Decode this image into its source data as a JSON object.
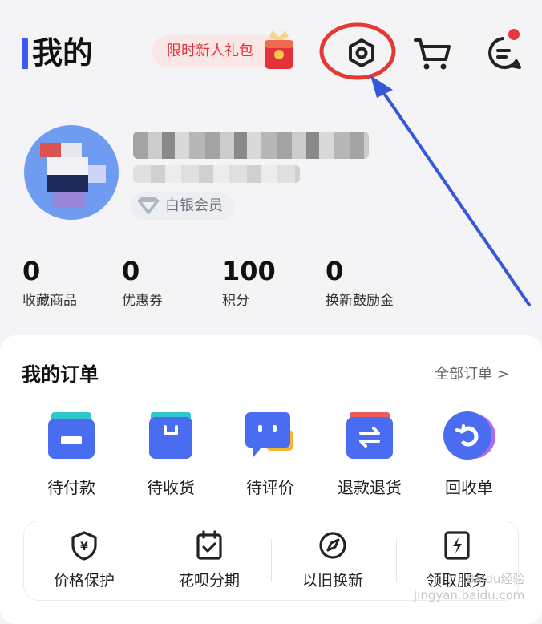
{
  "header": {
    "title": "我的",
    "promo_label": "限时新人礼包"
  },
  "profile": {
    "member_level": "白银会员"
  },
  "stats": [
    {
      "value": "0",
      "label": "收藏商品"
    },
    {
      "value": "0",
      "label": "优惠券"
    },
    {
      "value": "100",
      "label": "积分"
    },
    {
      "value": "0",
      "label": "换新鼓励金"
    }
  ],
  "orders": {
    "title": "我的订单",
    "all_link": "全部订单 >",
    "items": [
      {
        "label": "待付款",
        "icon": "wallet-icon"
      },
      {
        "label": "待收货",
        "icon": "package-icon"
      },
      {
        "label": "待评价",
        "icon": "review-chat-icon"
      },
      {
        "label": "退款退货",
        "icon": "refund-icon"
      },
      {
        "label": "回收单",
        "icon": "recycle-icon"
      }
    ]
  },
  "services": [
    {
      "label": "价格保护",
      "icon": "price-shield-icon"
    },
    {
      "label": "花呗分期",
      "icon": "calendar-check-icon"
    },
    {
      "label": "以旧换新",
      "icon": "trade-in-icon"
    },
    {
      "label": "领取服务",
      "icon": "service-bolt-icon"
    }
  ],
  "watermark": {
    "line1": "Baidu经验",
    "line2": "jingyan.baidu.com"
  },
  "colors": {
    "accent": "#3a5bf0",
    "promo_red": "#e0343a",
    "annotation_red": "#e53935",
    "annotation_blue": "#3558d8"
  }
}
